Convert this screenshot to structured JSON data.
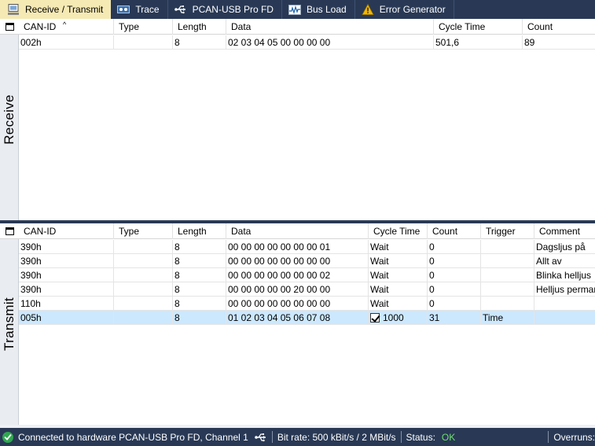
{
  "tabs": [
    {
      "label": "Receive / Transmit",
      "icon": "receive-transmit-icon",
      "active": true
    },
    {
      "label": "Trace",
      "icon": "trace-icon"
    },
    {
      "label": "PCAN-USB Pro FD",
      "icon": "usb-icon"
    },
    {
      "label": "Bus Load",
      "icon": "bus-load-icon"
    },
    {
      "label": "Error Generator",
      "icon": "warning-icon"
    }
  ],
  "receive": {
    "side_label": "Receive",
    "headers": [
      "CAN-ID",
      "Type",
      "Length",
      "Data",
      "Cycle Time",
      "Count"
    ],
    "rows": [
      {
        "can_id": "002h",
        "type": "",
        "length": "8",
        "data": "02 03 04 05 00 00 00 00",
        "cycle_time": "501,6",
        "count": "89"
      }
    ]
  },
  "transmit": {
    "side_label": "Transmit",
    "headers": [
      "CAN-ID",
      "Type",
      "Length",
      "Data",
      "Cycle Time",
      "Count",
      "Trigger",
      "Comment"
    ],
    "rows": [
      {
        "can_id": "390h",
        "type": "",
        "length": "8",
        "data": "00 00 00 00 00 00 00 01",
        "cycle_time": "Wait",
        "count": "0",
        "trigger": "",
        "comment": "Dagsljus på"
      },
      {
        "can_id": "390h",
        "type": "",
        "length": "8",
        "data": "00 00 00 00 00 00 00 00",
        "cycle_time": "Wait",
        "count": "0",
        "trigger": "",
        "comment": "Allt av"
      },
      {
        "can_id": "390h",
        "type": "",
        "length": "8",
        "data": "00 00 00 00 00 00 00 02",
        "cycle_time": "Wait",
        "count": "0",
        "trigger": "",
        "comment": "Blinka helljus"
      },
      {
        "can_id": "390h",
        "type": "",
        "length": "8",
        "data": "00 00 00 00 00 20 00 00",
        "cycle_time": "Wait",
        "count": "0",
        "trigger": "",
        "comment": "Helljus perman"
      },
      {
        "can_id": "110h",
        "type": "",
        "length": "8",
        "data": "00 00 00 00 00 00 00 00",
        "cycle_time": "Wait",
        "count": "0",
        "trigger": "",
        "comment": ""
      },
      {
        "can_id": "005h",
        "type": "",
        "length": "8",
        "data": "01 02 03 04 05 06 07 08",
        "cycle_time": "1000",
        "cycle_checked": true,
        "count": "31",
        "trigger": "Time",
        "comment": "",
        "selected": true
      }
    ]
  },
  "statusbar": {
    "connection": "Connected to hardware PCAN-USB Pro FD, Channel 1",
    "bitrate": "Bit rate: 500 kBit/s / 2 MBit/s",
    "status_label": "Status:",
    "status_value": "OK",
    "overruns_label": "Overruns:"
  },
  "colors": {
    "chrome": "#293955",
    "active_tab": "#f5e9b4",
    "selected_row": "#cce8ff",
    "status_ok": "#6ee06e"
  }
}
